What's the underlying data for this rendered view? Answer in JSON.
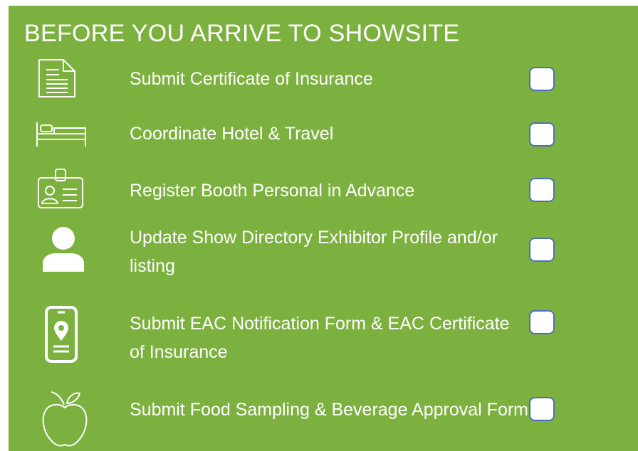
{
  "title": "BEFORE YOU ARRIVE TO SHOWSITE",
  "colors": {
    "panel": "#7cb13f",
    "text": "#ffffff",
    "checkbox_border": "#4a71b6"
  },
  "items": [
    {
      "icon": "document-icon",
      "label": "Submit Certificate of Insurance",
      "checked": false
    },
    {
      "icon": "hotel-bed-icon",
      "label": "Coordinate Hotel & Travel",
      "checked": false
    },
    {
      "icon": "badge-icon",
      "label": "Register Booth Personal in Advance",
      "checked": false
    },
    {
      "icon": "person-icon",
      "label": "Update Show Directory Exhibitor Profile and/or listing",
      "checked": false
    },
    {
      "icon": "mobile-location-icon",
      "label": "Submit EAC Notification Form & EAC Certificate of Insurance",
      "checked": false
    },
    {
      "icon": "apple-icon",
      "label": "Submit Food Sampling & Beverage Approval Form",
      "checked": false
    }
  ]
}
